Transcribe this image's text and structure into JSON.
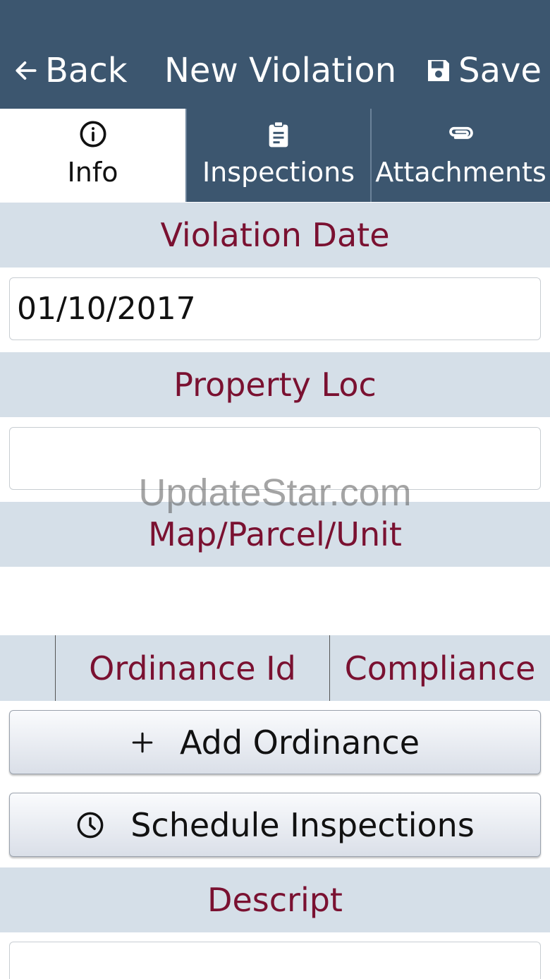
{
  "header": {
    "back_label": "Back",
    "title": "New Violation",
    "save_label": "Save",
    "background": "#3c566f"
  },
  "tabs": [
    {
      "label": "Info",
      "icon": "info-circle-icon",
      "active": true
    },
    {
      "label": "Inspections",
      "icon": "clipboard-icon",
      "active": false
    },
    {
      "label": "Attachments",
      "icon": "paperclip-icon",
      "active": false
    }
  ],
  "sections": {
    "violation_date": {
      "label": "Violation Date",
      "value": "01/10/2017"
    },
    "property_loc": {
      "label": "Property Loc",
      "value": ""
    },
    "map_parcel_unit": {
      "label": "Map/Parcel/Unit"
    },
    "descript": {
      "label": "Descript",
      "value": ""
    }
  },
  "ordinance_table": {
    "columns": [
      "",
      "Ordinance Id",
      "Compliance"
    ]
  },
  "buttons": {
    "add_ordinance": "Add Ordinance",
    "schedule_inspections": "Schedule Inspections"
  },
  "watermark": "UpdateStar.com",
  "colors": {
    "section_bg": "#d5dfe8",
    "section_text": "#7a1131"
  }
}
